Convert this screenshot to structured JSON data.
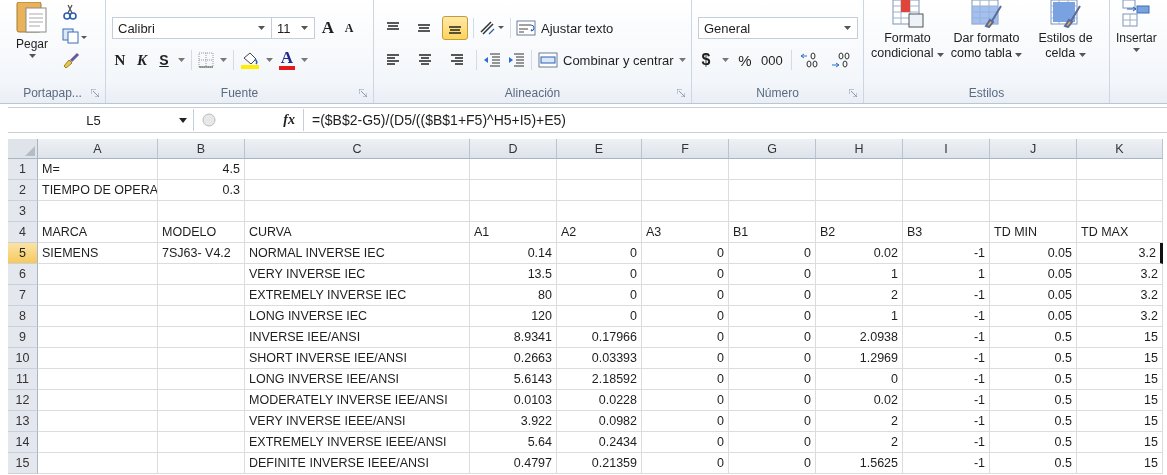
{
  "ribbon": {
    "clipboard": {
      "paste": "Pegar",
      "label": "Portapap..."
    },
    "font": {
      "name": "Calibri",
      "size": "11",
      "grow": "A",
      "shrink": "A",
      "bold": "N",
      "italic": "K",
      "underline": "S",
      "font_color_letter": "A",
      "label": "Fuente"
    },
    "alignment": {
      "vertical": [
        {
          "selected": false
        },
        {
          "selected": false
        },
        {
          "selected": true
        }
      ],
      "horizontal": [
        {
          "selected": false
        },
        {
          "selected": false
        },
        {
          "selected": false
        }
      ],
      "wrap": "Ajustar texto",
      "merge": "Combinar y centrar",
      "label": "Alineación"
    },
    "number": {
      "format": "General",
      "currency": "$",
      "percent": "%",
      "thousands": "000",
      "label": "Número"
    },
    "styles": {
      "buttons": [
        {
          "lines": [
            "Formato",
            "condicional"
          ]
        },
        {
          "lines": [
            "Dar formato",
            "como tabla"
          ]
        },
        {
          "lines": [
            "Estilos de",
            "celda"
          ]
        }
      ],
      "label": "Estilos"
    },
    "cells": {
      "insert": "Insertar"
    }
  },
  "formula_bar": {
    "name_box": "L5",
    "function_label": "fx",
    "formula": "=($B$2-G5)/(D5/(($B$1+F5)^H5+I5)+E5)"
  },
  "sheet": {
    "columns": [
      "A",
      "B",
      "C",
      "D",
      "E",
      "F",
      "G",
      "H",
      "I",
      "J",
      "K"
    ],
    "rows": [
      {
        "number": "1",
        "selected": false,
        "cells": [
          {
            "text": "M="
          },
          {
            "text": "4.5",
            "numeric": true
          }
        ]
      },
      {
        "number": "2",
        "selected": false,
        "cells": [
          {
            "text": "TIEMPO DE OPERA"
          },
          {
            "text": "0.3",
            "numeric": true
          }
        ]
      },
      {
        "number": "3",
        "selected": false,
        "cells": []
      },
      {
        "number": "4",
        "selected": false,
        "cells": [
          {
            "text": "MARCA"
          },
          {
            "text": "MODELO"
          },
          {
            "text": "CURVA"
          },
          {
            "text": "A1"
          },
          {
            "text": "A2"
          },
          {
            "text": "A3"
          },
          {
            "text": "B1"
          },
          {
            "text": "B2"
          },
          {
            "text": "B3"
          },
          {
            "text": "TD MIN"
          },
          {
            "text": "TD MAX"
          }
        ]
      },
      {
        "number": "5",
        "selected": true,
        "cells": [
          {
            "text": "SIEMENS"
          },
          {
            "text": "7SJ63- V4.2"
          },
          {
            "text": "NORMAL INVERSE IEC"
          },
          {
            "text": "0.14",
            "numeric": true
          },
          {
            "text": "0",
            "numeric": true
          },
          {
            "text": "0",
            "numeric": true
          },
          {
            "text": "0",
            "numeric": true
          },
          {
            "text": "0.02",
            "numeric": true
          },
          {
            "text": "-1",
            "numeric": true
          },
          {
            "text": "0.05",
            "numeric": true
          },
          {
            "text": "3.2",
            "numeric": true
          }
        ]
      },
      {
        "number": "6",
        "selected": false,
        "cells": [
          null,
          null,
          {
            "text": "VERY INVERSE IEC"
          },
          {
            "text": "13.5",
            "numeric": true
          },
          {
            "text": "0",
            "numeric": true
          },
          {
            "text": "0",
            "numeric": true
          },
          {
            "text": "0",
            "numeric": true
          },
          {
            "text": "1",
            "numeric": true
          },
          {
            "text": "1",
            "numeric": true
          },
          {
            "text": "0.05",
            "numeric": true
          },
          {
            "text": "3.2",
            "numeric": true
          }
        ]
      },
      {
        "number": "7",
        "selected": false,
        "cells": [
          null,
          null,
          {
            "text": "EXTREMELY INVERSE  IEC"
          },
          {
            "text": "80",
            "numeric": true
          },
          {
            "text": "0",
            "numeric": true
          },
          {
            "text": "0",
            "numeric": true
          },
          {
            "text": "0",
            "numeric": true
          },
          {
            "text": "2",
            "numeric": true
          },
          {
            "text": "-1",
            "numeric": true
          },
          {
            "text": "0.05",
            "numeric": true
          },
          {
            "text": "3.2",
            "numeric": true
          }
        ]
      },
      {
        "number": "8",
        "selected": false,
        "cells": [
          null,
          null,
          {
            "text": "LONG INVERSE  IEC"
          },
          {
            "text": "120",
            "numeric": true
          },
          {
            "text": "0",
            "numeric": true
          },
          {
            "text": "0",
            "numeric": true
          },
          {
            "text": "0",
            "numeric": true
          },
          {
            "text": "1",
            "numeric": true
          },
          {
            "text": "-1",
            "numeric": true
          },
          {
            "text": "0.05",
            "numeric": true
          },
          {
            "text": "3.2",
            "numeric": true
          }
        ]
      },
      {
        "number": "9",
        "selected": false,
        "cells": [
          null,
          null,
          {
            "text": "INVERSE IEE/ANSI"
          },
          {
            "text": "8.9341",
            "numeric": true
          },
          {
            "text": "0.17966",
            "numeric": true
          },
          {
            "text": "0",
            "numeric": true
          },
          {
            "text": "0",
            "numeric": true
          },
          {
            "text": "2.0938",
            "numeric": true
          },
          {
            "text": "-1",
            "numeric": true
          },
          {
            "text": "0.5",
            "numeric": true
          },
          {
            "text": "15",
            "numeric": true
          }
        ]
      },
      {
        "number": "10",
        "selected": false,
        "cells": [
          null,
          null,
          {
            "text": "SHORT INVERSE IEE/ANSI"
          },
          {
            "text": "0.2663",
            "numeric": true
          },
          {
            "text": "0.03393",
            "numeric": true
          },
          {
            "text": "0",
            "numeric": true
          },
          {
            "text": "0",
            "numeric": true
          },
          {
            "text": "1.2969",
            "numeric": true
          },
          {
            "text": "-1",
            "numeric": true
          },
          {
            "text": "0.5",
            "numeric": true
          },
          {
            "text": "15",
            "numeric": true
          }
        ]
      },
      {
        "number": "11",
        "selected": false,
        "cells": [
          null,
          null,
          {
            "text": "LONG INVERSE  IEE/ANSI"
          },
          {
            "text": "5.6143",
            "numeric": true
          },
          {
            "text": "2.18592",
            "numeric": true
          },
          {
            "text": "0",
            "numeric": true
          },
          {
            "text": "0",
            "numeric": true
          },
          {
            "text": "0",
            "numeric": true
          },
          {
            "text": "-1",
            "numeric": true
          },
          {
            "text": "0.5",
            "numeric": true
          },
          {
            "text": "15",
            "numeric": true
          }
        ]
      },
      {
        "number": "12",
        "selected": false,
        "cells": [
          null,
          null,
          {
            "text": "MODERATELY INVERSE IEE/ANSI"
          },
          {
            "text": "0.0103",
            "numeric": true
          },
          {
            "text": "0.0228",
            "numeric": true
          },
          {
            "text": "0",
            "numeric": true
          },
          {
            "text": "0",
            "numeric": true
          },
          {
            "text": "0.02",
            "numeric": true
          },
          {
            "text": "-1",
            "numeric": true
          },
          {
            "text": "0.5",
            "numeric": true
          },
          {
            "text": "15",
            "numeric": true
          }
        ]
      },
      {
        "number": "13",
        "selected": false,
        "cells": [
          null,
          null,
          {
            "text": "VERY INVERSE IEEE/ANSI"
          },
          {
            "text": "3.922",
            "numeric": true
          },
          {
            "text": "0.0982",
            "numeric": true
          },
          {
            "text": "0",
            "numeric": true
          },
          {
            "text": "0",
            "numeric": true
          },
          {
            "text": "2",
            "numeric": true
          },
          {
            "text": "-1",
            "numeric": true
          },
          {
            "text": "0.5",
            "numeric": true
          },
          {
            "text": "15",
            "numeric": true
          }
        ]
      },
      {
        "number": "14",
        "selected": false,
        "cells": [
          null,
          null,
          {
            "text": "EXTREMELY INVERSE  IEEE/ANSI"
          },
          {
            "text": "5.64",
            "numeric": true
          },
          {
            "text": "0.2434",
            "numeric": true
          },
          {
            "text": "0",
            "numeric": true
          },
          {
            "text": "0",
            "numeric": true
          },
          {
            "text": "2",
            "numeric": true
          },
          {
            "text": "-1",
            "numeric": true
          },
          {
            "text": "0.5",
            "numeric": true
          },
          {
            "text": "15",
            "numeric": true
          }
        ]
      },
      {
        "number": "15",
        "selected": false,
        "cells": [
          null,
          null,
          {
            "text": "DEFINITE INVERSE IEEE/ANSI"
          },
          {
            "text": "0.4797",
            "numeric": true
          },
          {
            "text": "0.21359",
            "numeric": true
          },
          {
            "text": "0",
            "numeric": true
          },
          {
            "text": "0",
            "numeric": true
          },
          {
            "text": "1.5625",
            "numeric": true
          },
          {
            "text": "-1",
            "numeric": true
          },
          {
            "text": "0.5",
            "numeric": true
          },
          {
            "text": "15",
            "numeric": true
          }
        ]
      }
    ]
  }
}
